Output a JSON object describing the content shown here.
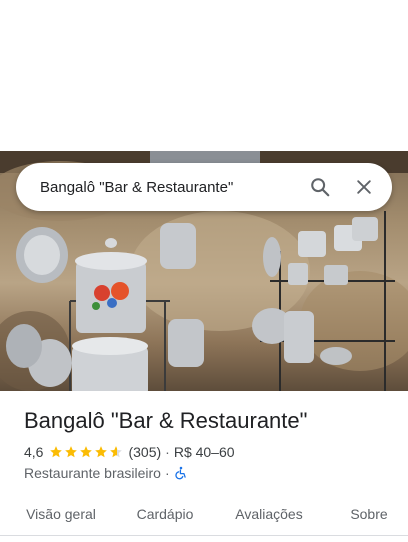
{
  "search": {
    "query": "Bangalô \"Bar & Restaurante\""
  },
  "place": {
    "name": "Bangalô \"Bar & Restaurante\"",
    "rating": "4,6",
    "stars": 4.6,
    "reviews": "(305)",
    "price": "R$ 40–60",
    "category": "Restaurante brasileiro",
    "rating_separator": "·",
    "category_separator": "·",
    "star_color": "#fbbc04",
    "accessibility_color": "#1a73e8"
  },
  "tabs": [
    {
      "label": "Visão geral",
      "active": true
    },
    {
      "label": "Cardápio",
      "active": false
    },
    {
      "label": "Avaliações",
      "active": false
    },
    {
      "label": "Sobre",
      "active": false
    }
  ],
  "colors": {
    "accent": "#00796b",
    "text_primary": "#202124",
    "text_secondary": "#5f6368"
  },
  "icons": {
    "search": "search-icon",
    "close": "close-icon",
    "accessibility": "wheelchair-icon"
  }
}
